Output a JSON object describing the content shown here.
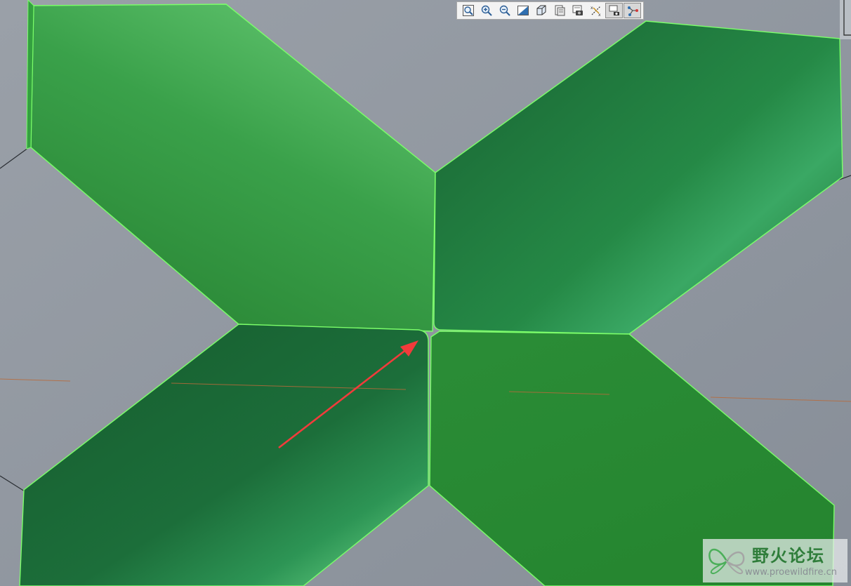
{
  "toolbar": {
    "buttons": [
      {
        "icon": "refit-icon"
      },
      {
        "icon": "zoom-in-icon"
      },
      {
        "icon": "zoom-out-icon"
      },
      {
        "icon": "repaint-icon"
      },
      {
        "icon": "orient-view-icon"
      },
      {
        "icon": "saved-views-icon"
      },
      {
        "icon": "view-manager-icon"
      },
      {
        "icon": "datum-display-icon"
      },
      {
        "icon": "display-style-icon",
        "active": true
      },
      {
        "icon": "spin-center-icon",
        "active": true
      }
    ]
  },
  "viewport": {
    "colors": {
      "background": "#8e95a0",
      "surface_light": "#5cc06a",
      "surface_mid": "#2f9a42",
      "surface_dark": "#1a6a3a",
      "edge_highlight": "#7cff6a",
      "annotation_arrow": "#f23b3b",
      "datum_line": "#b86a3a"
    }
  },
  "watermark": {
    "title": "野火论坛",
    "url": "www.proewildfire.cn"
  }
}
